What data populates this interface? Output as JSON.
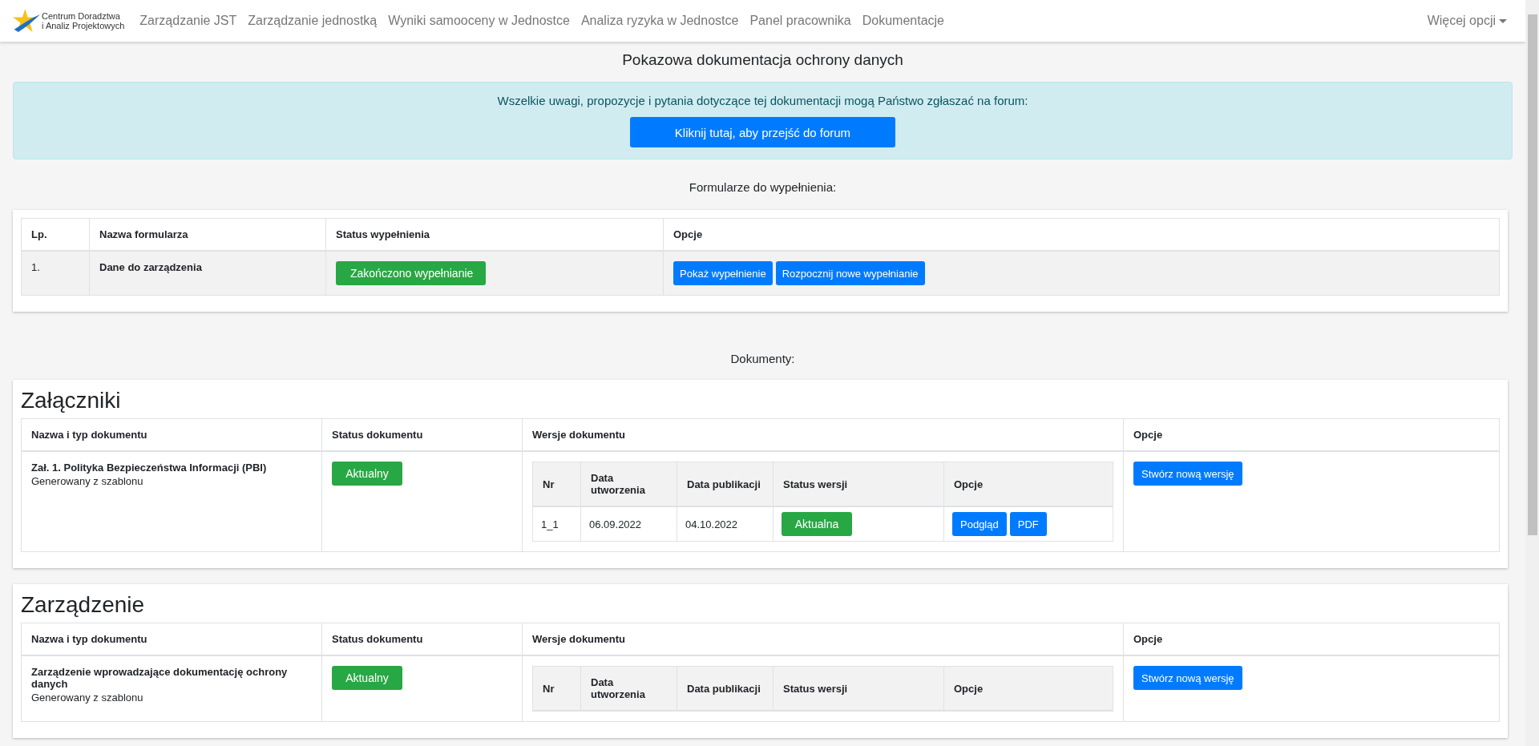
{
  "navbar": {
    "logo_lines": [
      "Centrum Doradztwa",
      "i Analiz Projektowych"
    ],
    "items": [
      "Zarządzanie JST",
      "Zarządzanie jednostką",
      "Wyniki samooceny w Jednostce",
      "Analiza ryzyka w Jednostce",
      "Panel pracownika",
      "Dokumentacje"
    ],
    "more": "Więcej opcji"
  },
  "page_title": "Pokazowa dokumentacja ochrony danych",
  "notice": {
    "text": "Wszelkie uwagi, propozycje i pytania dotyczące tej dokumentacji mogą Państwo zgłaszać na forum:",
    "button": "Kliknij tutaj, aby przejść do forum"
  },
  "forms": {
    "heading": "Formularze do wypełnienia:",
    "columns": [
      "Lp.",
      "Nazwa formularza",
      "Status wypełnienia",
      "Opcje"
    ],
    "rows": [
      {
        "number": "1.",
        "name": "Dane do zarządzenia",
        "status": "Zakończono wypełnianie",
        "options": [
          "Pokaż wypełnienie",
          "Rozpocznij nowe wypełnianie"
        ]
      }
    ]
  },
  "documents": {
    "heading": "Dokumenty:",
    "sections": [
      {
        "title": "Załączniki",
        "columns": [
          "Nazwa i typ dokumentu",
          "Status dokumentu",
          "Wersje dokumentu",
          "Opcje"
        ],
        "rows": [
          {
            "name": "Zał. 1. Polityka Bezpieczeństwa Informacji (PBI)",
            "source": "Generowany z szablonu",
            "status": "Aktualny",
            "version_columns": [
              "Nr",
              "Data utworzenia",
              "Data publikacji",
              "Status wersji",
              "Opcje"
            ],
            "versions": [
              {
                "number": "1_1",
                "created": "06.09.2022",
                "published": "04.10.2022",
                "status": "Aktualna",
                "options": [
                  "Podgląd",
                  "PDF"
                ]
              }
            ],
            "action": "Stwórz nową wersję"
          }
        ]
      },
      {
        "title": "Zarządzenie",
        "columns": [
          "Nazwa i typ dokumentu",
          "Status dokumentu",
          "Wersje dokumentu",
          "Opcje"
        ],
        "rows": [
          {
            "name": "Zarządzenie wprowadzające dokumentację ochrony danych",
            "source": "Generowany z szablonu",
            "status": "Aktualny",
            "version_columns": [
              "Nr",
              "Data utworzenia",
              "Data publikacji",
              "Status wersji",
              "Opcje"
            ],
            "versions": [],
            "action": "Stwórz nową wersję"
          }
        ]
      }
    ]
  }
}
